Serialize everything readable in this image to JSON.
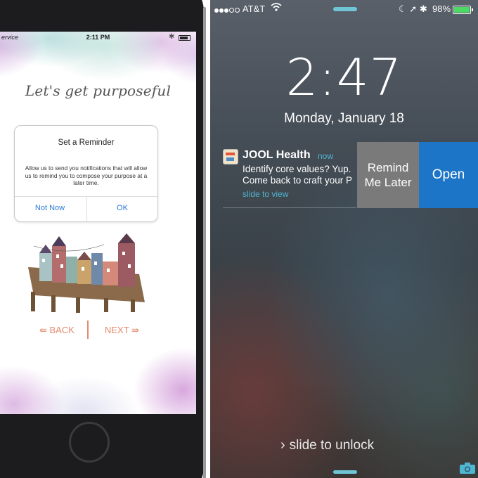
{
  "left_phone": {
    "status": {
      "carrier": "ervice",
      "time": "2:11 PM"
    },
    "headline": "Let's get purposeful",
    "dialog": {
      "title": "Set a Reminder",
      "message": "Allow us to send you notifications that will allow us to remind you to compose your purpose at a later time.",
      "not_now": "Not Now",
      "ok": "OK"
    },
    "nav": {
      "back": "⇚ BACK",
      "next": "NEXT ⇛"
    }
  },
  "lock_screen": {
    "status": {
      "carrier": "AT&T",
      "battery_pct": "98%"
    },
    "clock": "2:47",
    "date": "Monday, January 18",
    "notification": {
      "app": "JOOL Health",
      "time": "now",
      "line1": "Identify core values? Yup.",
      "line2": "Come back to craft your P",
      "hint": "slide to view"
    },
    "actions": {
      "remind_line1": "Remind",
      "remind_line2": "Me Later",
      "open": "Open"
    },
    "unlock": "slide to unlock",
    "accent_colors": {
      "open": "#1d75c7",
      "remind": "#7a7a7a",
      "link": "#4fb5d2",
      "battery": "#4cd964"
    }
  }
}
